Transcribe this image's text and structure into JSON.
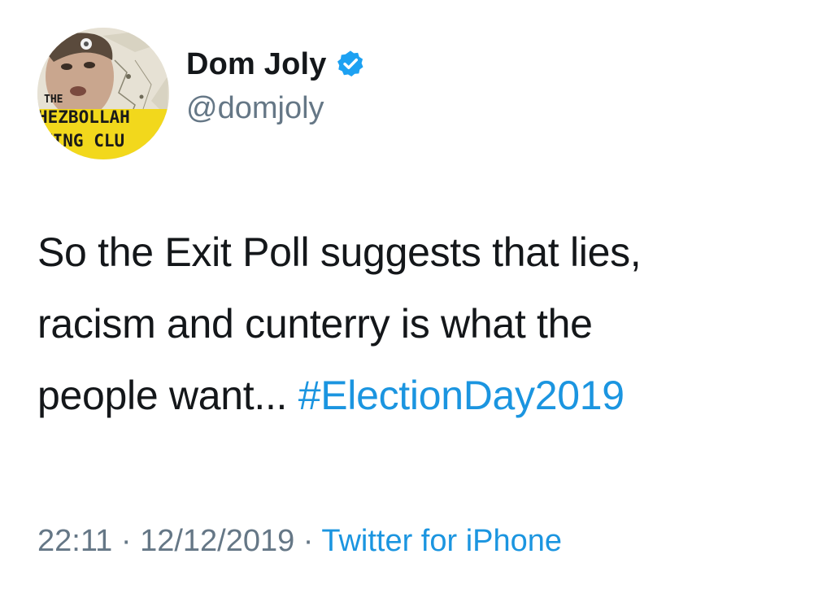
{
  "author": {
    "display_name": "Dom Joly",
    "handle": "@domjoly",
    "verified": true,
    "avatar_text": [
      "THE",
      "HEZBOLLAH",
      "KING CLU"
    ]
  },
  "tweet": {
    "line1": "So the Exit Poll suggests that lies,",
    "line2": "racism and cunterry is what the",
    "line3_text": "people want... ",
    "hashtag": "#ElectionDay2019"
  },
  "meta": {
    "time": "22:11",
    "separator": " · ",
    "date": "12/12/2019",
    "source": "Twitter for iPhone"
  },
  "colors": {
    "text": "#14171a",
    "secondary": "#657786",
    "link": "#1b95e0",
    "verified": "#1da1f2"
  }
}
